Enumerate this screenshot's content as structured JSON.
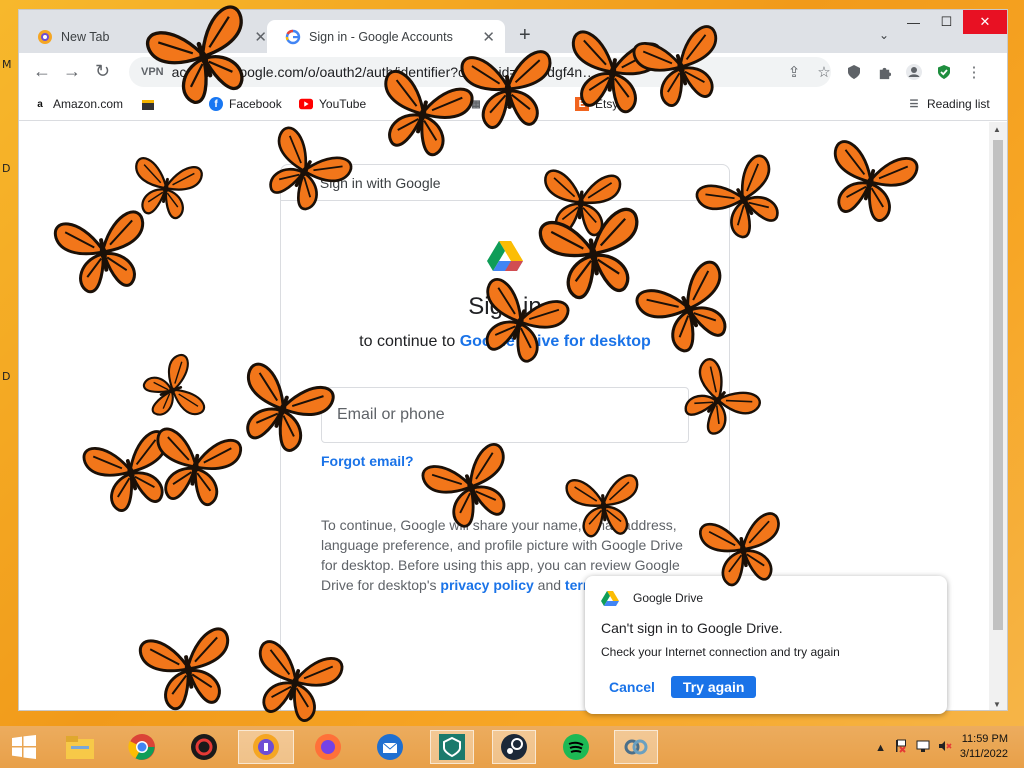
{
  "desktop": {
    "edge_letters": [
      "M",
      "D",
      "D"
    ]
  },
  "window": {
    "minimize": "—",
    "maximize": "☐",
    "close": "✕"
  },
  "tabs": [
    {
      "title": "New Tab",
      "close": "✕"
    },
    {
      "title": "Sign in - Google Accounts",
      "close": "✕"
    }
  ],
  "new_tab": "+",
  "tab_search": "⌄",
  "toolbar": {
    "back": "←",
    "forward": "→",
    "reload": "↻",
    "vpn": "VPN",
    "url": "accounts.google.com/o/oauth2/auth/identifier?client_id=94…dgf4n…",
    "share": "⇪",
    "star": "☆",
    "extension": "🧩",
    "menu": "⋮"
  },
  "bookmarks": [
    {
      "label": "Amazon.com",
      "icon": "amazon-icon"
    },
    {
      "label": "Facebook",
      "icon": "facebook-icon"
    },
    {
      "label": "YouTube",
      "icon": "youtube-icon"
    },
    {
      "label": "Addons",
      "icon": "addons-icon"
    },
    {
      "label": "Etsy",
      "icon": "etsy-icon"
    }
  ],
  "reading_list": "Reading list",
  "signin": {
    "header": "Sign in with Google",
    "heading": "Sign in",
    "continue_prefix": "to continue to ",
    "continue_app": "Google Drive for desktop",
    "email_placeholder": "Email or phone",
    "forgot": "Forgot email?",
    "consent_text": "To continue, Google will share your name, email address, language preference, and profile picture with Google Drive for desktop. Before using this app, you can review Google Drive for desktop's ",
    "privacy_link": "privacy policy",
    "and_text": " and ",
    "terms_link": "terms of service",
    "period": "."
  },
  "toast": {
    "app": "Google Drive",
    "title": "Can't sign in to Google Drive.",
    "message": "Check your Internet connection and try again",
    "cancel": "Cancel",
    "retry": "Try again"
  },
  "taskbar": {
    "time": "11:59 PM",
    "date": "3/11/2022",
    "tray_up": "▲"
  },
  "colors": {
    "accent": "#1a73e8",
    "close_red": "#e81123",
    "butterfly_orange": "#f2761a"
  }
}
